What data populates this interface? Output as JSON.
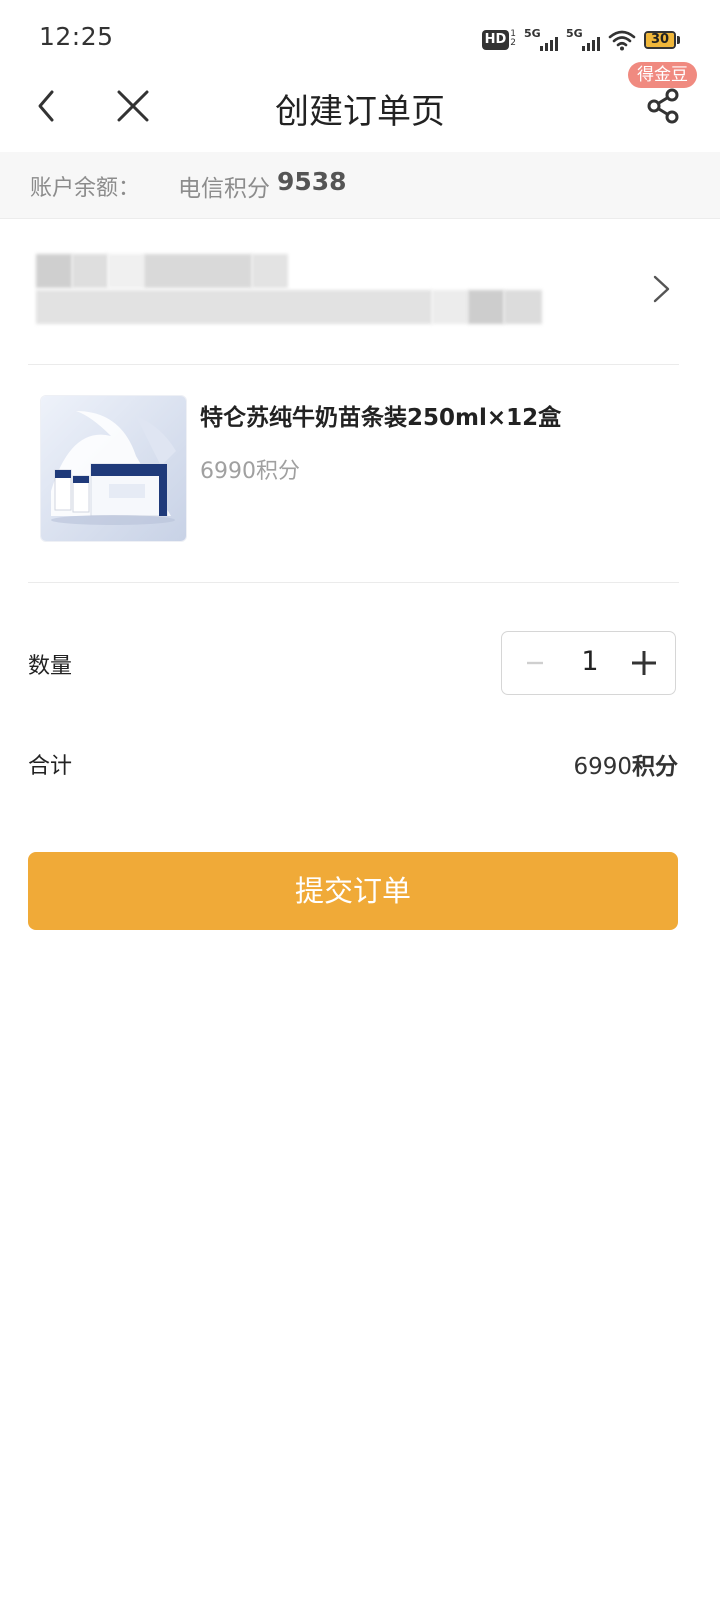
{
  "status_bar": {
    "time": "12:25",
    "hd_label": "HD",
    "hd_sub": "1\n2",
    "net1_label": "5G",
    "net2_label": "5G",
    "battery_level": 30,
    "battery_text": "30",
    "icons": [
      "hd-voice-icon",
      "signal-5g-icon",
      "signal-5g-icon",
      "wifi-icon",
      "battery-icon"
    ]
  },
  "nav": {
    "title": "创建订单页",
    "share_badge": "得金豆",
    "icons": [
      "back-icon",
      "close-icon",
      "share-icon"
    ]
  },
  "balance": {
    "label": "账户余额：",
    "source": "电信积分",
    "value": "9538"
  },
  "product": {
    "name": "特仑苏纯牛奶苗条装250ml×12盒",
    "price": "6990积分"
  },
  "quantity": {
    "label": "数量",
    "value": "1"
  },
  "total": {
    "label": "合计",
    "amount": "6990",
    "unit": "积分"
  },
  "submit": {
    "label": "提交订单"
  },
  "colors": {
    "accent": "#f0aa38",
    "badge": "#f08a80",
    "balance_bg": "#f7f7f7"
  }
}
